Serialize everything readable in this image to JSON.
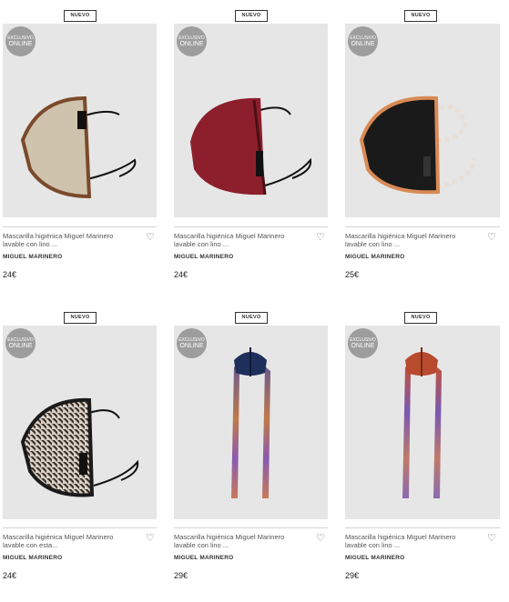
{
  "products": [
    {
      "badge": "NUEVO",
      "exclusive_line1": "EXCLUSIVO",
      "exclusive_line2": "ONLINE",
      "title_line1": "Mascarilla higiénica Miguel Marinero",
      "title_line2": "lavable con lino ...",
      "brand": "MIGUEL MARINERO",
      "price": "24€",
      "image_icon": "beige-linen-face-mask"
    },
    {
      "badge": "NUEVO",
      "exclusive_line1": "EXCLUSIVO",
      "exclusive_line2": "ONLINE",
      "title_line1": "Mascarilla higiénica Miguel Marinero",
      "title_line2": "lavable con lino ...",
      "brand": "MIGUEL MARINERO",
      "price": "24€",
      "image_icon": "burgundy-face-mask"
    },
    {
      "badge": "NUEVO",
      "exclusive_line1": "EXCLUSIVO",
      "exclusive_line2": "ONLINE",
      "title_line1": "Mascarilla higiénica Miguel Marinero",
      "title_line2": "lavable con lino ...",
      "brand": "MIGUEL MARINERO",
      "price": "25€",
      "image_icon": "black-orange-face-mask"
    },
    {
      "badge": "NUEVO",
      "exclusive_line1": "EXCLUSIVO",
      "exclusive_line2": "ONLINE",
      "title_line1": "Mascarilla higiénica Miguel Marinero",
      "title_line2": "lavable con esta...",
      "brand": "MIGUEL MARINERO",
      "price": "24€",
      "image_icon": "houndstooth-face-mask"
    },
    {
      "badge": "NUEVO",
      "exclusive_line1": "EXCLUSIVO",
      "exclusive_line2": "ONLINE",
      "title_line1": "Mascarilla higiénica Miguel Marinero",
      "title_line2": "lavable con lino ...",
      "brand": "MIGUEL MARINERO",
      "price": "29€",
      "image_icon": "navy-mask-with-scarf-straps"
    },
    {
      "badge": "NUEVO",
      "exclusive_line1": "EXCLUSIVO",
      "exclusive_line2": "ONLINE",
      "title_line1": "Mascarilla higiénica Miguel Marinero",
      "title_line2": "lavable con lino ...",
      "brand": "MIGUEL MARINERO",
      "price": "29€",
      "image_icon": "orange-mask-with-scarf-straps"
    }
  ],
  "colors": {
    "image_background": "#e6e6e6",
    "exclusive_badge": "#9d9d9d",
    "mask_beige": "#cfc3ad",
    "mask_brown_trim": "#7a4a2a",
    "mask_burgundy": "#8c1f2b",
    "mask_black": "#1a1a1a",
    "mask_orange_trim": "#d98a55",
    "mask_navy": "#1f2f5c",
    "mask_rust": "#b84a2e"
  },
  "wishlist_icon": "heart-outline-icon"
}
